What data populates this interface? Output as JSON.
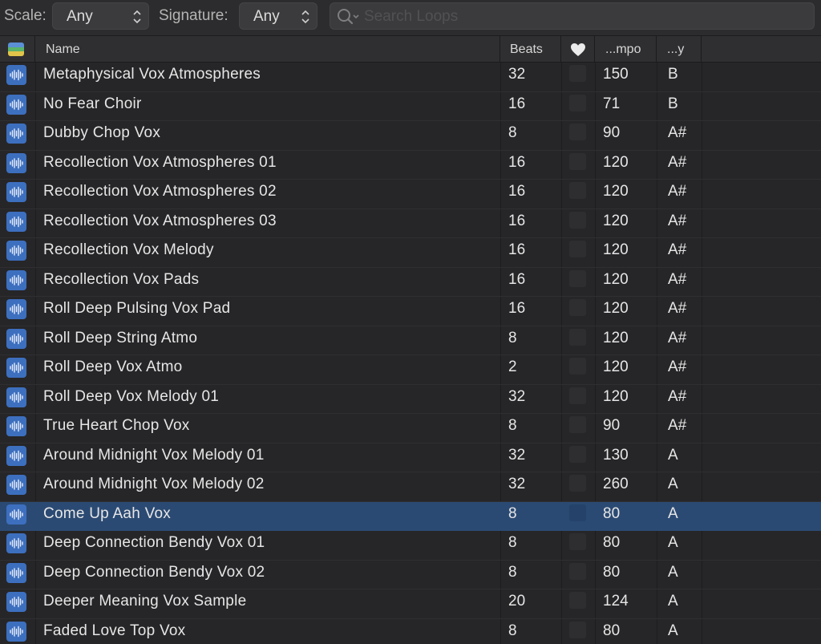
{
  "filters": {
    "scale_label": "Scale:",
    "scale_value": "Any",
    "signature_label": "Signature:",
    "signature_value": "Any",
    "search_placeholder": "Search Loops"
  },
  "columns": {
    "name": "Name",
    "beats": "Beats",
    "favorite_icon": "heart-icon",
    "tempo": "...mpo",
    "key": "...y"
  },
  "colors": {
    "accent_selection": "#2b4a73",
    "loop_icon": "#3d6fbf"
  },
  "rows": [
    {
      "name": "Metaphysical Vox Atmospheres",
      "beats": "32",
      "tempo": "150",
      "key": "B"
    },
    {
      "name": "No Fear Choir",
      "beats": "16",
      "tempo": "71",
      "key": "B"
    },
    {
      "name": "Dubby Chop Vox",
      "beats": "8",
      "tempo": "90",
      "key": "A#"
    },
    {
      "name": "Recollection Vox Atmospheres 01",
      "beats": "16",
      "tempo": "120",
      "key": "A#"
    },
    {
      "name": "Recollection Vox Atmospheres 02",
      "beats": "16",
      "tempo": "120",
      "key": "A#"
    },
    {
      "name": "Recollection Vox Atmospheres 03",
      "beats": "16",
      "tempo": "120",
      "key": "A#"
    },
    {
      "name": "Recollection Vox Melody",
      "beats": "16",
      "tempo": "120",
      "key": "A#"
    },
    {
      "name": "Recollection Vox Pads",
      "beats": "16",
      "tempo": "120",
      "key": "A#"
    },
    {
      "name": "Roll Deep Pulsing Vox Pad",
      "beats": "16",
      "tempo": "120",
      "key": "A#"
    },
    {
      "name": "Roll Deep String Atmo",
      "beats": "8",
      "tempo": "120",
      "key": "A#"
    },
    {
      "name": "Roll Deep Vox Atmo",
      "beats": "2",
      "tempo": "120",
      "key": "A#"
    },
    {
      "name": "Roll Deep Vox Melody 01",
      "beats": "32",
      "tempo": "120",
      "key": "A#"
    },
    {
      "name": "True Heart Chop Vox",
      "beats": "8",
      "tempo": "90",
      "key": "A#"
    },
    {
      "name": "Around Midnight Vox Melody 01",
      "beats": "32",
      "tempo": "130",
      "key": "A"
    },
    {
      "name": "Around Midnight Vox Melody 02",
      "beats": "32",
      "tempo": "260",
      "key": "A"
    },
    {
      "name": "Come Up Aah Vox",
      "beats": "8",
      "tempo": "80",
      "key": "A",
      "selected": true
    },
    {
      "name": "Deep Connection Bendy Vox 01",
      "beats": "8",
      "tempo": "80",
      "key": "A"
    },
    {
      "name": "Deep Connection Bendy Vox 02",
      "beats": "8",
      "tempo": "80",
      "key": "A"
    },
    {
      "name": "Deeper Meaning Vox Sample",
      "beats": "20",
      "tempo": "124",
      "key": "A"
    },
    {
      "name": "Faded Love Top Vox",
      "beats": "8",
      "tempo": "80",
      "key": "A"
    }
  ]
}
